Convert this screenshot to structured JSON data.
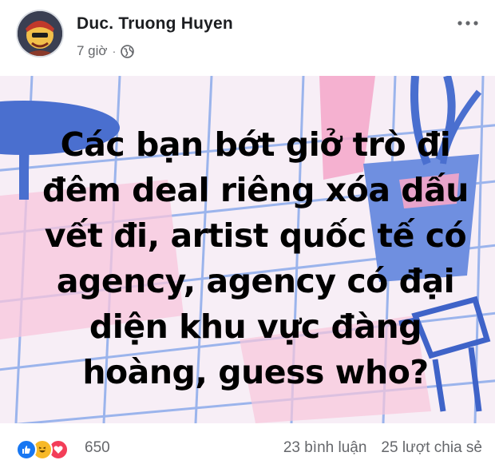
{
  "post": {
    "author": "Duc. Truong Huyen",
    "time": "7 giờ",
    "separator": "·",
    "privacy_icon": "globe-icon",
    "more_icon": "more-options-icon",
    "text": "Các bạn bớt giở trò đi\nđêm deal riêng xóa dấu\nvết đi, artist quốc tế có\nagency, agency có đại\ndiện khu vực đàng\nhoàng, guess who?"
  },
  "footer": {
    "reaction_icons": [
      "like-icon",
      "haha-icon",
      "love-icon"
    ],
    "reaction_count": "650",
    "comments": "23 bình luận",
    "shares": "25 lượt chia sẻ"
  },
  "colors": {
    "like": "#1877f2",
    "haha": "#f7b928",
    "love": "#f33e58",
    "image_bg": "#f7eef6",
    "grid": "#8aa6e8",
    "accent_pink": "#f5a6c9",
    "accent_blue": "#4a6fcf"
  }
}
